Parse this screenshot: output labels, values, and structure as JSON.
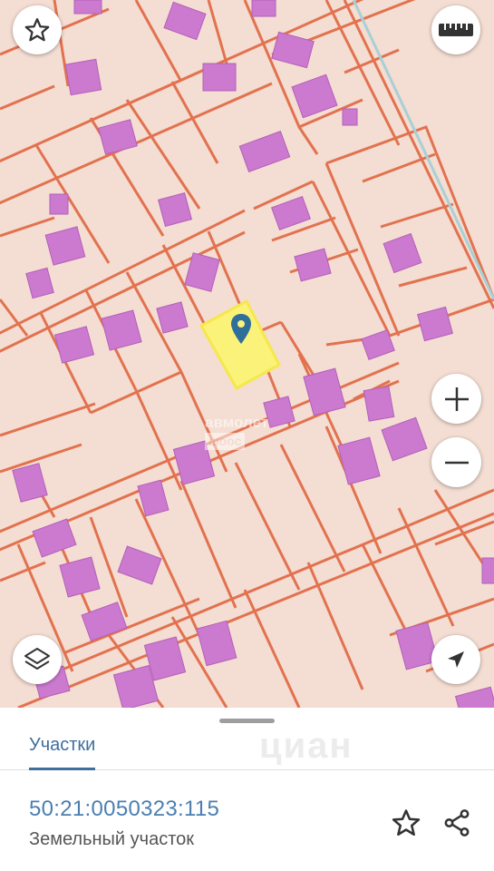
{
  "map": {
    "watermark_line1": "авмолет",
    "watermark_line2": "шоос",
    "icons": {
      "favorite": "star-outline-icon",
      "ruler": "ruler-icon",
      "zoom_in": "plus-icon",
      "zoom_out": "minus-icon",
      "layers": "layers-icon",
      "locate": "navigation-arrow-icon",
      "pin": "map-pin-icon"
    },
    "colors": {
      "background": "#f4ddd2",
      "parcel_border": "#e2724f",
      "building": "#cc7ad0",
      "selected_parcel": "#fbf27a",
      "pin": "#2f6f9a"
    }
  },
  "sheet": {
    "tab_label": "Участки",
    "cadastral_number": "50:21:0050323:115",
    "object_type": "Земельный участок",
    "brand_watermark": "циан"
  }
}
